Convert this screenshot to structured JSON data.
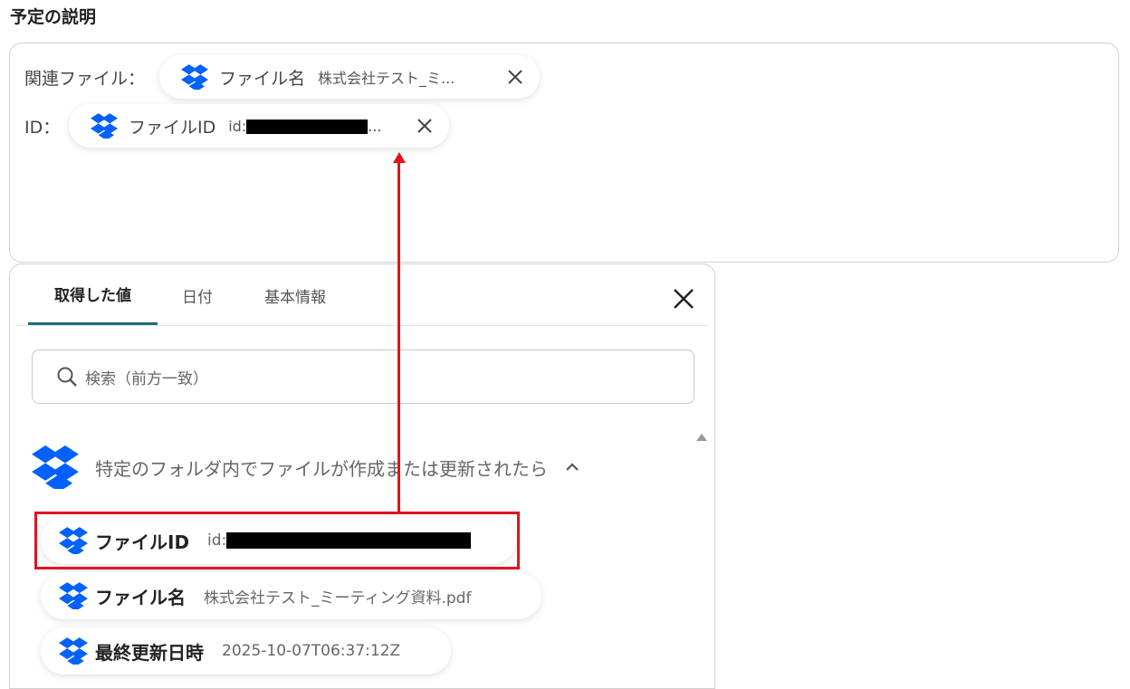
{
  "section_title": "予定の説明",
  "description": {
    "related_file_label": "関連ファイル：",
    "id_label": "ID：",
    "file_name_pill": {
      "name": "ファイル名",
      "value": "株式会社テスト_ミ..."
    },
    "file_id_pill": {
      "name": "ファイルID",
      "value_prefix": "id:",
      "value_suffix": "..."
    }
  },
  "popup": {
    "tabs": [
      {
        "label": "取得した値",
        "active": true
      },
      {
        "label": "日付",
        "active": false
      },
      {
        "label": "基本情報",
        "active": false
      }
    ],
    "search_placeholder": "検索（前方一致）",
    "group_title": "特定のフォルダ内でファイルが作成または更新されたら",
    "items": [
      {
        "name": "ファイルID",
        "value": "id:"
      },
      {
        "name": "ファイル名",
        "value": "株式会社テスト_ミーティング資料.pdf"
      },
      {
        "name": "最終更新日時",
        "value": "2025-10-07T06:37:12Z"
      }
    ]
  },
  "colors": {
    "dropbox_blue": "#0061fe",
    "annotation_red": "#e0141e",
    "active_tab_underline": "#1f6a7e"
  },
  "icons": [
    "dropbox-icon",
    "close-icon",
    "search-icon",
    "chevron-up-icon",
    "scroll-up-arrow-icon"
  ]
}
